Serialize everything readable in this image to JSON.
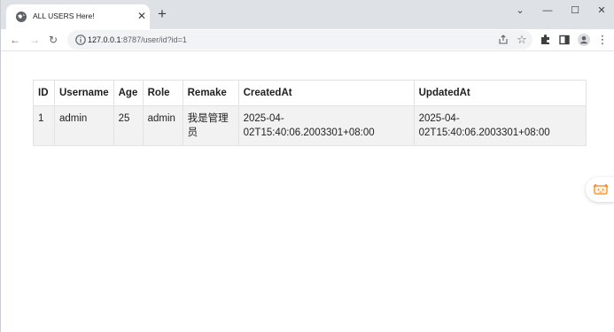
{
  "browser": {
    "tab": {
      "title": "ALL USERS Here!",
      "icon": "globe-icon",
      "close_glyph": "✕"
    },
    "new_tab_glyph": "+",
    "window_controls": {
      "collapse": "⌄",
      "minimize": "—",
      "maximize": "☐",
      "close": "✕"
    },
    "nav": {
      "back": "←",
      "forward": "→",
      "reload": "↻"
    },
    "address": {
      "host": "127.0.0.1",
      "rest": ":8787/user/id?id=1"
    },
    "omnibox_icons": {
      "share": "share-icon",
      "bookmark": "☆"
    },
    "toolbar_icons": {
      "extensions": "puzzle-icon",
      "side_panel": "side-panel-icon",
      "profile": "profile-icon",
      "menu": "⋮"
    }
  },
  "table": {
    "headers": [
      "ID",
      "Username",
      "Age",
      "Role",
      "Remake",
      "CreatedAt",
      "UpdatedAt"
    ],
    "rows": [
      [
        "1",
        "admin",
        "25",
        "admin",
        "我是管理员",
        "2025-04-02T15:40:06.2003301+08:00",
        "2025-04-02T15:40:06.2003301+08:00"
      ]
    ]
  },
  "side_widget": {
    "icon": "mascot-icon"
  },
  "colors": {
    "accent": "#f08a24",
    "tab_strip": "#dee1e6",
    "row_bg": "#f2f2f2"
  }
}
